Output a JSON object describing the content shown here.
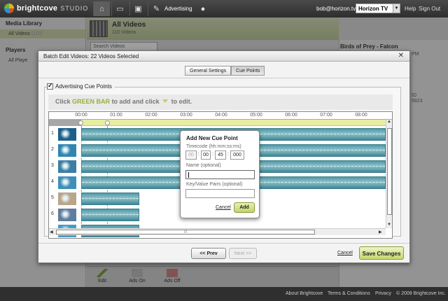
{
  "app": {
    "brand": "brightcove",
    "product": "STUDIO",
    "nav_advertising": "Advertising",
    "user_email": "bob@horizon.tv",
    "account": "Horizon TV",
    "help": "Help",
    "sign_out": "Sign Out"
  },
  "sidebar": {
    "media_library": "Media Library",
    "all_videos": "All Videos",
    "all_videos_count": "(110)",
    "players": "Players",
    "all_players": "All Playe"
  },
  "main": {
    "title": "All Videos",
    "subtitle": "110 Videos",
    "search_placeholder": "Search Videos"
  },
  "right_panel": {
    "title": "Birds of Prey - Falcon",
    "frag1": "PM",
    "frag2": "ID",
    "frag3": "5823"
  },
  "bottom_toolbar": {
    "edit": "Edit",
    "ads_on": "Ads On",
    "ads_off": "Ads Off"
  },
  "footer": {
    "about": "About Brightcove",
    "terms": "Terms & Conditions",
    "privacy": "Privacy",
    "copyright": "© 2009 Brightcove Inc."
  },
  "dialog": {
    "title": "Batch Edit Videos: 22 Videos Selected",
    "close": "✕",
    "tabs": [
      "General Settings",
      "Cue Points"
    ],
    "active_tab": "Cue Points",
    "cue_points_label": "Advertising Cue Points",
    "instruction_pre": "Click",
    "instruction_green": "GREEN BAR",
    "instruction_mid": "to add and click",
    "instruction_post": "to edit.",
    "time_ticks": [
      "00:00",
      "01:00",
      "02:00",
      "03:00",
      "04:00",
      "05:00",
      "06:00",
      "07:00",
      "08:00"
    ],
    "rows": [
      {
        "num": "1",
        "thumb_color": "#1d5f8a",
        "clip_fraction": 1.0
      },
      {
        "num": "2",
        "thumb_color": "#2f86b0",
        "clip_fraction": 1.0
      },
      {
        "num": "3",
        "thumb_color": "#3b7fa4",
        "clip_fraction": 1.0
      },
      {
        "num": "4",
        "thumb_color": "#3f8fb8",
        "clip_fraction": 1.0
      },
      {
        "num": "5",
        "thumb_color": "#b9a58a",
        "clip_fraction": 0.19
      },
      {
        "num": "6",
        "thumb_color": "#5f7d9c",
        "clip_fraction": 0.19
      },
      {
        "num": "",
        "thumb_color": "#4a9ac6",
        "clip_fraction": 0.19
      }
    ],
    "prev": "<< Prev",
    "next": "Next >>",
    "cancel": "Cancel",
    "save": "Save Changes"
  },
  "popup": {
    "title": "Add New Cue Point",
    "timecode_label": "Timecode (hh:mm:ss:ms)",
    "timecode": [
      "00",
      "00",
      "45",
      "000"
    ],
    "name_label": "Name (optional)",
    "name_value": "",
    "kv_label": "Key/Value Pairs (optional)",
    "kv_value": "",
    "cancel": "Cancel",
    "add": "Add"
  },
  "colors": {
    "accent_green": "#96b23a",
    "clip_teal": "#4f97a6"
  }
}
